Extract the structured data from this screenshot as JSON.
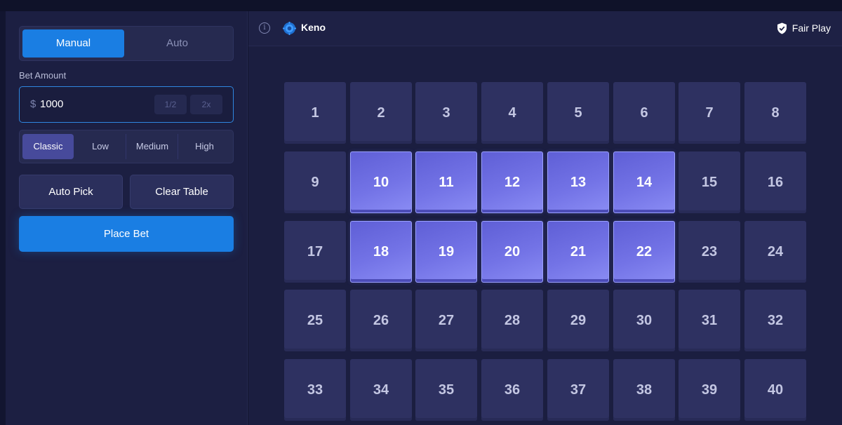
{
  "sidebar": {
    "modes": [
      "Manual",
      "Auto"
    ],
    "active_mode": "Manual",
    "bet_amount_label": "Bet Amount",
    "bet_currency": "$",
    "bet_amount_value": "1000",
    "half_label": "1/2",
    "double_label": "2x",
    "risk_levels": [
      "Classic",
      "Low",
      "Medium",
      "High"
    ],
    "active_risk": "Classic",
    "auto_pick_label": "Auto Pick",
    "clear_table_label": "Clear Table",
    "place_bet_label": "Place Bet"
  },
  "header": {
    "game_title": "Keno",
    "fair_play_label": "Fair Play",
    "info_icon": "info-icon",
    "game_icon": "keno-gem-icon",
    "fair_play_icon": "shield-check-icon"
  },
  "board": {
    "numbers": [
      1,
      2,
      3,
      4,
      5,
      6,
      7,
      8,
      9,
      10,
      11,
      12,
      13,
      14,
      15,
      16,
      17,
      18,
      19,
      20,
      21,
      22,
      23,
      24,
      25,
      26,
      27,
      28,
      29,
      30,
      31,
      32,
      33,
      34,
      35,
      36,
      37,
      38,
      39,
      40
    ],
    "selected": [
      10,
      11,
      12,
      13,
      14,
      18,
      19,
      20,
      21,
      22
    ],
    "columns": 8
  },
  "colors": {
    "accent": "#1a7ee3",
    "tile": "#2e3161",
    "tile_selected": "#7373e6",
    "background": "#1b1e40"
  }
}
